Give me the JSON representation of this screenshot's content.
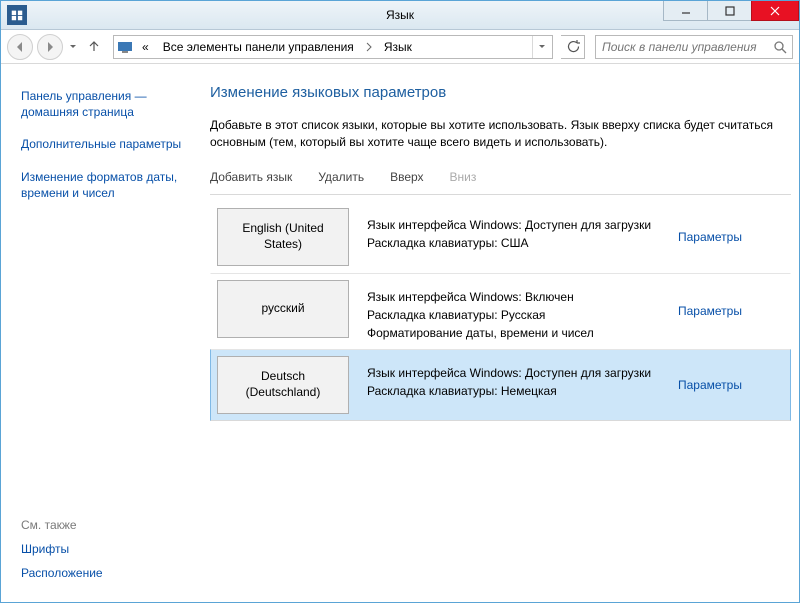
{
  "window": {
    "title": "Язык"
  },
  "nav": {
    "breadcrumb_prefix": "«",
    "breadcrumb_1": "Все элементы панели управления",
    "breadcrumb_2": "Язык",
    "search_placeholder": "Поиск в панели управления"
  },
  "sidebar": {
    "links": [
      "Панель управления — домашняя страница",
      "Дополнительные параметры",
      "Изменение форматов даты, времени и чисел"
    ],
    "see_also_header": "См. также",
    "see_also": [
      "Шрифты",
      "Расположение"
    ]
  },
  "content": {
    "heading": "Изменение языковых параметров",
    "desc": "Добавьте в этот список языки, которые вы хотите использовать. Язык вверху списка будет считаться основным (тем, который вы хотите чаще всего видеть и использовать).",
    "toolbar": {
      "add": "Добавить язык",
      "remove": "Удалить",
      "up": "Вверх",
      "down": "Вниз"
    },
    "options_label": "Параметры",
    "languages": [
      {
        "name": "English (United States)",
        "info": [
          "Язык интерфейса Windows: Доступен для загрузки",
          "Раскладка клавиатуры: США"
        ]
      },
      {
        "name": "русский",
        "info": [
          "Язык интерфейса Windows: Включен",
          "Раскладка клавиатуры: Русская",
          "Форматирование даты, времени и чисел"
        ]
      },
      {
        "name": "Deutsch (Deutschland)",
        "info": [
          "Язык интерфейса Windows: Доступен для загрузки",
          "Раскладка клавиатуры: Немецкая"
        ]
      }
    ],
    "selected_index": 2,
    "disabled_tool": "down"
  }
}
